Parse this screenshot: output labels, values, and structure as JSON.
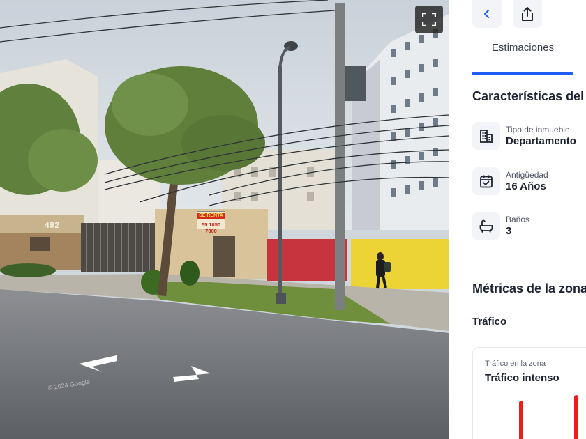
{
  "street_view": {
    "house_number": "492",
    "sign_title": "SE RENTA",
    "sign_phone": "55 1850 7000",
    "watermark": "© 2024 Google",
    "fullscreen_icon": "fullscreen-icon"
  },
  "panel": {
    "back_icon": "chevron-left-icon",
    "share_icon": "share-icon",
    "tabs": [
      {
        "label": "Estimaciones",
        "active": true
      }
    ],
    "characteristics_title": "Características del",
    "features": [
      {
        "icon": "building-icon",
        "label": "Tipo de inmueble",
        "value": "Departamento"
      },
      {
        "icon": "calendar-check-icon",
        "label": "Antigüedad",
        "value": "16 Años"
      },
      {
        "icon": "bathtub-icon",
        "label": "Baños",
        "value": "3"
      }
    ],
    "metrics_title": "Métricas de la zona",
    "traffic": {
      "title": "Tráfico",
      "card_label": "Tráfico en la zona",
      "card_value": "Tráfico intenso",
      "bar_color": "#f01c1c"
    }
  },
  "colors": {
    "accent": "#1f5ef5",
    "text": "#1d2230",
    "icon_bg": "#f3f4f7"
  }
}
